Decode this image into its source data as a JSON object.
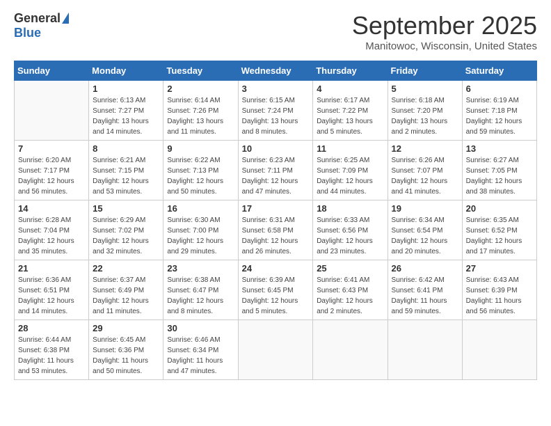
{
  "header": {
    "logo_general": "General",
    "logo_blue": "Blue",
    "month_title": "September 2025",
    "subtitle": "Manitowoc, Wisconsin, United States"
  },
  "days_of_week": [
    "Sunday",
    "Monday",
    "Tuesday",
    "Wednesday",
    "Thursday",
    "Friday",
    "Saturday"
  ],
  "weeks": [
    [
      {
        "day": "",
        "info": ""
      },
      {
        "day": "1",
        "info": "Sunrise: 6:13 AM\nSunset: 7:27 PM\nDaylight: 13 hours\nand 14 minutes."
      },
      {
        "day": "2",
        "info": "Sunrise: 6:14 AM\nSunset: 7:26 PM\nDaylight: 13 hours\nand 11 minutes."
      },
      {
        "day": "3",
        "info": "Sunrise: 6:15 AM\nSunset: 7:24 PM\nDaylight: 13 hours\nand 8 minutes."
      },
      {
        "day": "4",
        "info": "Sunrise: 6:17 AM\nSunset: 7:22 PM\nDaylight: 13 hours\nand 5 minutes."
      },
      {
        "day": "5",
        "info": "Sunrise: 6:18 AM\nSunset: 7:20 PM\nDaylight: 13 hours\nand 2 minutes."
      },
      {
        "day": "6",
        "info": "Sunrise: 6:19 AM\nSunset: 7:18 PM\nDaylight: 12 hours\nand 59 minutes."
      }
    ],
    [
      {
        "day": "7",
        "info": "Sunrise: 6:20 AM\nSunset: 7:17 PM\nDaylight: 12 hours\nand 56 minutes."
      },
      {
        "day": "8",
        "info": "Sunrise: 6:21 AM\nSunset: 7:15 PM\nDaylight: 12 hours\nand 53 minutes."
      },
      {
        "day": "9",
        "info": "Sunrise: 6:22 AM\nSunset: 7:13 PM\nDaylight: 12 hours\nand 50 minutes."
      },
      {
        "day": "10",
        "info": "Sunrise: 6:23 AM\nSunset: 7:11 PM\nDaylight: 12 hours\nand 47 minutes."
      },
      {
        "day": "11",
        "info": "Sunrise: 6:25 AM\nSunset: 7:09 PM\nDaylight: 12 hours\nand 44 minutes."
      },
      {
        "day": "12",
        "info": "Sunrise: 6:26 AM\nSunset: 7:07 PM\nDaylight: 12 hours\nand 41 minutes."
      },
      {
        "day": "13",
        "info": "Sunrise: 6:27 AM\nSunset: 7:05 PM\nDaylight: 12 hours\nand 38 minutes."
      }
    ],
    [
      {
        "day": "14",
        "info": "Sunrise: 6:28 AM\nSunset: 7:04 PM\nDaylight: 12 hours\nand 35 minutes."
      },
      {
        "day": "15",
        "info": "Sunrise: 6:29 AM\nSunset: 7:02 PM\nDaylight: 12 hours\nand 32 minutes."
      },
      {
        "day": "16",
        "info": "Sunrise: 6:30 AM\nSunset: 7:00 PM\nDaylight: 12 hours\nand 29 minutes."
      },
      {
        "day": "17",
        "info": "Sunrise: 6:31 AM\nSunset: 6:58 PM\nDaylight: 12 hours\nand 26 minutes."
      },
      {
        "day": "18",
        "info": "Sunrise: 6:33 AM\nSunset: 6:56 PM\nDaylight: 12 hours\nand 23 minutes."
      },
      {
        "day": "19",
        "info": "Sunrise: 6:34 AM\nSunset: 6:54 PM\nDaylight: 12 hours\nand 20 minutes."
      },
      {
        "day": "20",
        "info": "Sunrise: 6:35 AM\nSunset: 6:52 PM\nDaylight: 12 hours\nand 17 minutes."
      }
    ],
    [
      {
        "day": "21",
        "info": "Sunrise: 6:36 AM\nSunset: 6:51 PM\nDaylight: 12 hours\nand 14 minutes."
      },
      {
        "day": "22",
        "info": "Sunrise: 6:37 AM\nSunset: 6:49 PM\nDaylight: 12 hours\nand 11 minutes."
      },
      {
        "day": "23",
        "info": "Sunrise: 6:38 AM\nSunset: 6:47 PM\nDaylight: 12 hours\nand 8 minutes."
      },
      {
        "day": "24",
        "info": "Sunrise: 6:39 AM\nSunset: 6:45 PM\nDaylight: 12 hours\nand 5 minutes."
      },
      {
        "day": "25",
        "info": "Sunrise: 6:41 AM\nSunset: 6:43 PM\nDaylight: 12 hours\nand 2 minutes."
      },
      {
        "day": "26",
        "info": "Sunrise: 6:42 AM\nSunset: 6:41 PM\nDaylight: 11 hours\nand 59 minutes."
      },
      {
        "day": "27",
        "info": "Sunrise: 6:43 AM\nSunset: 6:39 PM\nDaylight: 11 hours\nand 56 minutes."
      }
    ],
    [
      {
        "day": "28",
        "info": "Sunrise: 6:44 AM\nSunset: 6:38 PM\nDaylight: 11 hours\nand 53 minutes."
      },
      {
        "day": "29",
        "info": "Sunrise: 6:45 AM\nSunset: 6:36 PM\nDaylight: 11 hours\nand 50 minutes."
      },
      {
        "day": "30",
        "info": "Sunrise: 6:46 AM\nSunset: 6:34 PM\nDaylight: 11 hours\nand 47 minutes."
      },
      {
        "day": "",
        "info": ""
      },
      {
        "day": "",
        "info": ""
      },
      {
        "day": "",
        "info": ""
      },
      {
        "day": "",
        "info": ""
      }
    ]
  ]
}
